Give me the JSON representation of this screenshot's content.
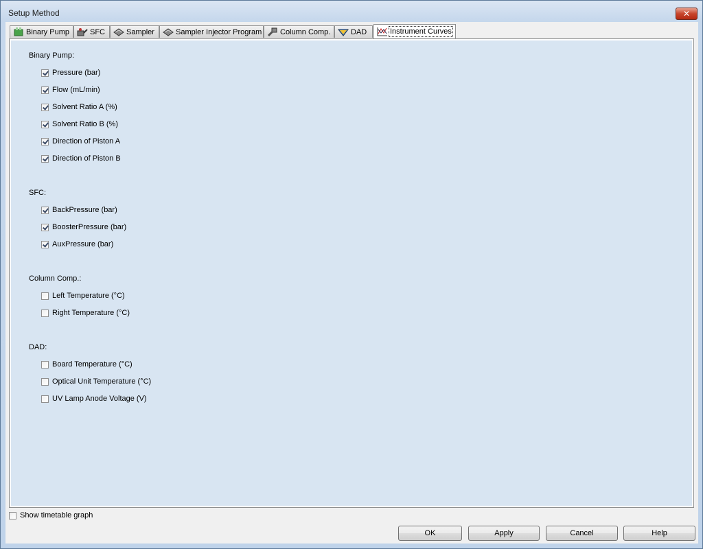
{
  "window": {
    "title": "Setup Method",
    "close_glyph": "✕"
  },
  "tabs": [
    {
      "label": "Binary Pump",
      "icon": "binary-pump-icon"
    },
    {
      "label": "SFC",
      "icon": "sfc-icon"
    },
    {
      "label": "Sampler",
      "icon": "sampler-icon"
    },
    {
      "label": "Sampler Injector Program",
      "icon": "sampler-injector-icon"
    },
    {
      "label": "Column Comp.",
      "icon": "column-comp-icon"
    },
    {
      "label": "DAD",
      "icon": "dad-icon"
    },
    {
      "label": "Instrument Curves",
      "icon": "instrument-curves-icon",
      "active": true
    }
  ],
  "groups": {
    "binary_pump": {
      "title": "Binary Pump:",
      "items": [
        {
          "label": "Pressure (bar)",
          "checked": true
        },
        {
          "label": "Flow (mL/min)",
          "checked": true
        },
        {
          "label": "Solvent Ratio A (%)",
          "checked": true
        },
        {
          "label": "Solvent Ratio B (%)",
          "checked": true
        },
        {
          "label": "Direction of Piston A",
          "checked": true
        },
        {
          "label": "Direction of Piston B",
          "checked": true
        }
      ]
    },
    "sfc": {
      "title": "SFC:",
      "items": [
        {
          "label": "BackPressure (bar)",
          "checked": true
        },
        {
          "label": "BoosterPressure (bar)",
          "checked": true
        },
        {
          "label": "AuxPressure (bar)",
          "checked": true
        }
      ]
    },
    "column_comp": {
      "title": "Column Comp.:",
      "items": [
        {
          "label": "Left Temperature (°C)",
          "checked": false
        },
        {
          "label": "Right Temperature (°C)",
          "checked": false
        }
      ]
    },
    "dad": {
      "title": "DAD:",
      "items": [
        {
          "label": "Board Temperature (°C)",
          "checked": false
        },
        {
          "label": "Optical Unit Temperature (°C)",
          "checked": false
        },
        {
          "label": "UV Lamp Anode Voltage (V)",
          "checked": false
        }
      ]
    }
  },
  "footer": {
    "show_timetable_label": "Show timetable graph",
    "show_timetable_checked": false,
    "ok_label": "OK",
    "apply_label": "Apply",
    "cancel_label": "Cancel",
    "help_label": "Help"
  }
}
